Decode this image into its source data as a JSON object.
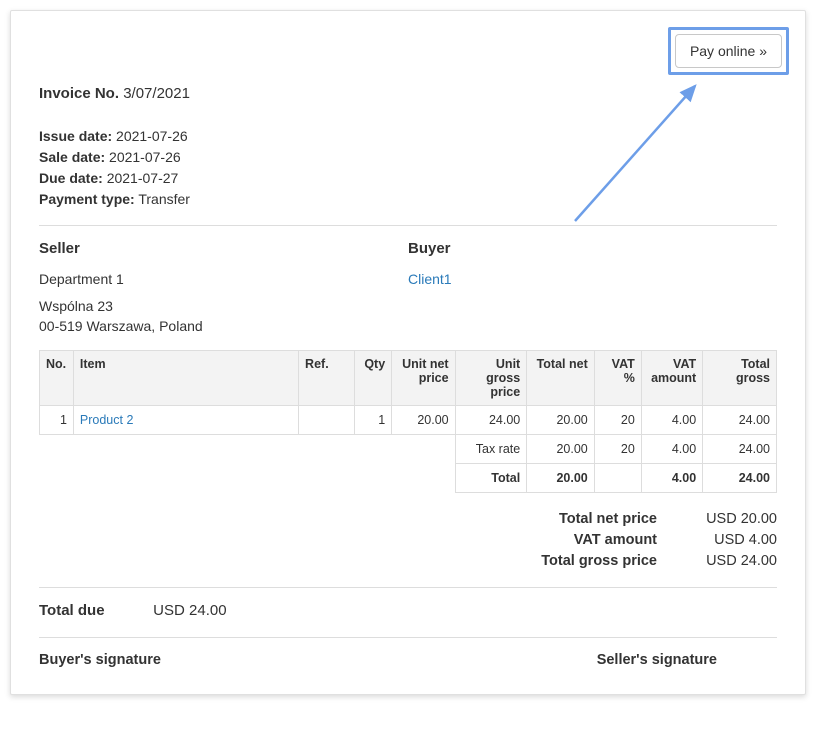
{
  "payButton": "Pay online »",
  "invoiceNoLabel": "Invoice No.",
  "invoiceNo": "3/07/2021",
  "meta": {
    "issueDateLabel": "Issue date:",
    "issueDate": "2021-07-26",
    "saleDateLabel": "Sale date:",
    "saleDate": "2021-07-26",
    "dueDateLabel": "Due date:",
    "dueDate": "2021-07-27",
    "paymentTypeLabel": "Payment type:",
    "paymentType": "Transfer"
  },
  "seller": {
    "title": "Seller",
    "name": "Department 1",
    "addr1": "Wspólna 23",
    "addr2": "00-519 Warszawa, Poland"
  },
  "buyer": {
    "title": "Buyer",
    "name": "Client1"
  },
  "headers": {
    "no": "No.",
    "item": "Item",
    "ref": "Ref.",
    "qty": "Qty",
    "unitNetPrice": "Unit net price",
    "unitGrossPrice": "Unit gross price",
    "totalNet": "Total net",
    "vatPct": "VAT %",
    "vatAmount": "VAT amount",
    "totalGross": "Total gross"
  },
  "line": {
    "no": "1",
    "item": "Product 2",
    "ref": "",
    "qty": "1",
    "unitNetPrice": "20.00",
    "unitGrossPrice": "24.00",
    "totalNet": "20.00",
    "vatPct": "20",
    "vatAmount": "4.00",
    "totalGross": "24.00"
  },
  "taxRateLabel": "Tax rate",
  "taxRow": {
    "totalNet": "20.00",
    "vatPct": "20",
    "vatAmount": "4.00",
    "totalGross": "24.00"
  },
  "totalRowLabel": "Total",
  "totalRow": {
    "totalNet": "20.00",
    "vatPct": "",
    "vatAmount": "4.00",
    "totalGross": "24.00"
  },
  "summary": {
    "totalNetPriceLabel": "Total net price",
    "totalNetPrice": "USD 20.00",
    "vatAmountLabel": "VAT amount",
    "vatAmount": "USD 4.00",
    "totalGrossPriceLabel": "Total gross price",
    "totalGrossPrice": "USD 24.00"
  },
  "totalDueLabel": "Total due",
  "totalDue": "USD 24.00",
  "buyerSignature": "Buyer's signature",
  "sellerSignature": "Seller's signature"
}
